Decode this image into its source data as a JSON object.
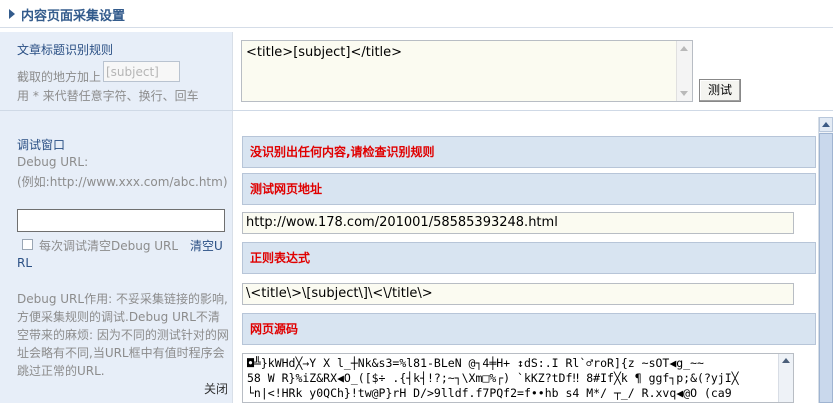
{
  "header": {
    "title": "内容页面采集设置"
  },
  "title_rule": {
    "label": "文章标题识别规则",
    "prefix_text": "截取的地方加上",
    "placeholder_value": "[subject]",
    "note": "用 * 来代替任意字符、换行、回车",
    "textarea_value": "<title>[subject]</title>",
    "test_button": "测试"
  },
  "debug": {
    "title": "调试窗口",
    "url_label": "Debug URL:",
    "url_example": "(例如:http://www.xxx.com/abc.htm)",
    "url_value": "",
    "checkbox_label": "每次调试清空Debug URL",
    "clear_link": "清空U",
    "clear_link_cont": "RL",
    "help_text": "Debug URL作用: 不妥采集链接的影响,方便采集规则的调试.Debug URL不清空带来的麻烦: 因为不同的测试针对的网址会略有不同,当URL框中有值时程序会跳过正常的URL.",
    "close_link": "关闭"
  },
  "results": {
    "error_msg": "没识别出任何内容,请检查识别规则",
    "test_url_label": "测试网页地址",
    "test_url_value": "http://wow.178.com/201001/58585393248.html",
    "regex_label": "正则表达式",
    "regex_value": "\\<title\\>\\[subject\\]\\<\\/title\\>",
    "source_label": "网页源码",
    "source_lines": [
      "◘╩}kWHd╳→Y  X  l_┼Nk&s3=%l81-BLeN @┐4╪H+  ↕dS:.I Rl`♂roR]{z  ~sOT◀g_~~",
      "58  W  R}%iZ&RX◀O_([$÷   .{┤k┤!?;~┐\\Xm□%┌) `kKZ?tDf‼ 8#If╳k ¶ ggf┐p;&(?yjI╳",
      "└n|<!HRk  y0QCh}!tw@P}rH  D/>9lldf.f7PQf2=f••hb s4  M*/   ┬_/ R.xvq◀@O  (ca9"
    ]
  }
}
